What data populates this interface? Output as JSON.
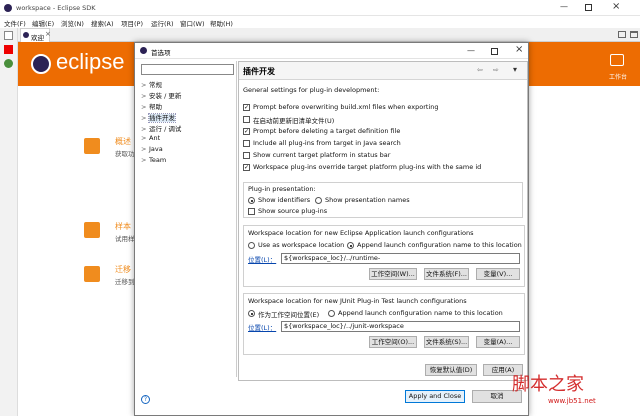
{
  "window": {
    "title": "workspace - Eclipse SDK"
  },
  "menu": [
    "文件(F)",
    "编辑(E)",
    "浏览(N)",
    "搜索(A)",
    "项目(P)",
    "运行(R)",
    "窗口(W)",
    "帮助(H)"
  ],
  "tab": {
    "label": "欢迎"
  },
  "banner": {
    "logo_text": "eclipse",
    "workbench_label": "工作台"
  },
  "welcome_items": [
    {
      "title": "概述",
      "subtitle": "获取功"
    },
    {
      "title": "样本",
      "subtitle": "试用样"
    },
    {
      "title": "迁移",
      "subtitle": "迁移到"
    }
  ],
  "dialog": {
    "title": "首选项",
    "filter_value": "",
    "tree": [
      {
        "label": "常规",
        "arrow": ">"
      },
      {
        "label": "安装 / 更新",
        "arrow": ">"
      },
      {
        "label": "帮助",
        "arrow": ">"
      },
      {
        "label": "插件开发",
        "arrow": ">",
        "selected": true
      },
      {
        "label": "运行 / 调试",
        "arrow": ">"
      },
      {
        "label": "Ant",
        "arrow": ">"
      },
      {
        "label": "Java",
        "arrow": ">"
      },
      {
        "label": "Team",
        "arrow": ">"
      }
    ],
    "page_title": "插件开发",
    "nav_glyphs": {
      "back": "⇦",
      "forward": "⇨",
      "menu": "▾"
    },
    "intro": "General settings for plug-in development:",
    "checkboxes": [
      {
        "label": "Prompt before overwriting build.xml files when exporting",
        "checked": true
      },
      {
        "label": "在启动前更新旧清单文件(U)",
        "checked": false
      },
      {
        "label": "Prompt before deleting a target definition file",
        "checked": true
      },
      {
        "label": "Include all plug-ins from target in Java search",
        "checked": false
      },
      {
        "label": "Show current target platform in status bar",
        "checked": false
      },
      {
        "label": "Workspace plug-ins override target platform plug-ins with the same id",
        "checked": true
      }
    ],
    "presentation": {
      "label": "Plug-in presentation:",
      "identifiers": "Show identifiers",
      "names": "Show presentation names",
      "source": "Show source plug-ins"
    },
    "eclipse_app": {
      "label": "Workspace location for new Eclipse Application launch configurations",
      "opt1": "Use as workspace location",
      "opt2": "Append launch configuration name to this location",
      "location_label": "位置(L)：",
      "location_value": "${workspace_loc}/../runtime-",
      "btn_workspace": "工作空间(W)...",
      "btn_filesystem": "文件系统(F)...",
      "btn_variables": "变量(V)..."
    },
    "junit": {
      "label": "Workspace location for new JUnit Plug-in Test launch configurations",
      "opt1": "作为工作空间位置(E)",
      "opt2": "Append launch configuration name to this location",
      "location_label": "位置(L)：",
      "location_value": "${workspace_loc}/../junit-workspace",
      "btn_workspace": "工作空间(O)...",
      "btn_filesystem": "文件系统(S)...",
      "btn_variables": "变量(A)..."
    },
    "restore_defaults": "恢复默认值(D)",
    "apply": "应用(A)",
    "apply_close": "Apply and Close",
    "cancel": "取消"
  },
  "watermark": {
    "text": "脚本之家",
    "url": "www.jb51.net"
  }
}
